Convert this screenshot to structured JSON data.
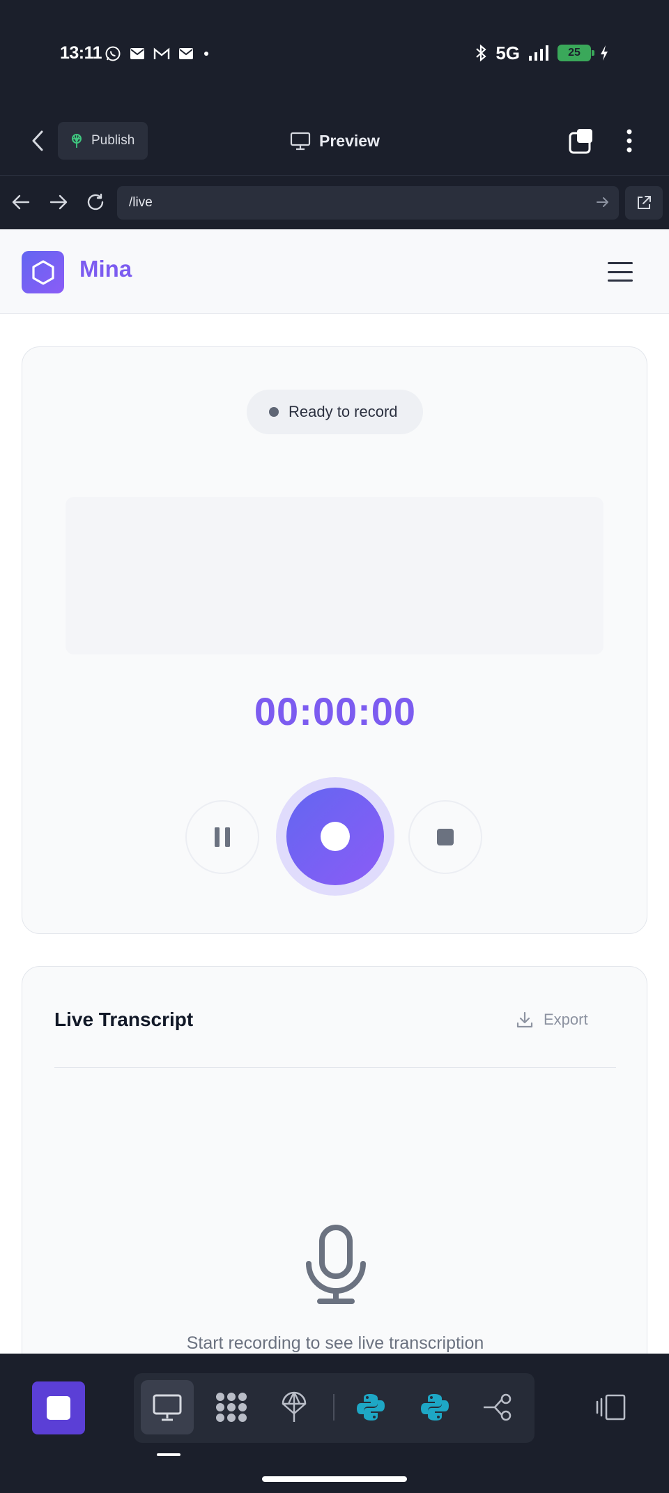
{
  "status_bar": {
    "time": "13:11",
    "network": "5G",
    "battery": "25",
    "notification_icons": [
      "whatsapp-icon",
      "mail-icon",
      "gmail-icon",
      "mail-icon",
      "dot-icon"
    ],
    "system_icons": [
      "bluetooth-icon",
      "signal-icon",
      "battery-charging-icon"
    ]
  },
  "toolbar": {
    "publish_label": "Publish",
    "preview_label": "Preview"
  },
  "urlbar": {
    "url": "/live"
  },
  "app": {
    "brand": "Mina"
  },
  "recorder": {
    "status": "Ready to record",
    "timer": "00:00:00"
  },
  "transcript": {
    "title": "Live Transcript",
    "export_label": "Export",
    "empty_message": "Start recording to see live transcription"
  },
  "dock": {
    "items": [
      "monitor-icon",
      "grid-icon",
      "deploy-icon",
      "python-icon",
      "python-icon",
      "share-icon"
    ]
  },
  "colors": {
    "accent": "#7c5cf0",
    "chrome_bg": "#1b1f2b",
    "battery_green": "#3aa85a",
    "python_teal": "#1ea7c5"
  }
}
